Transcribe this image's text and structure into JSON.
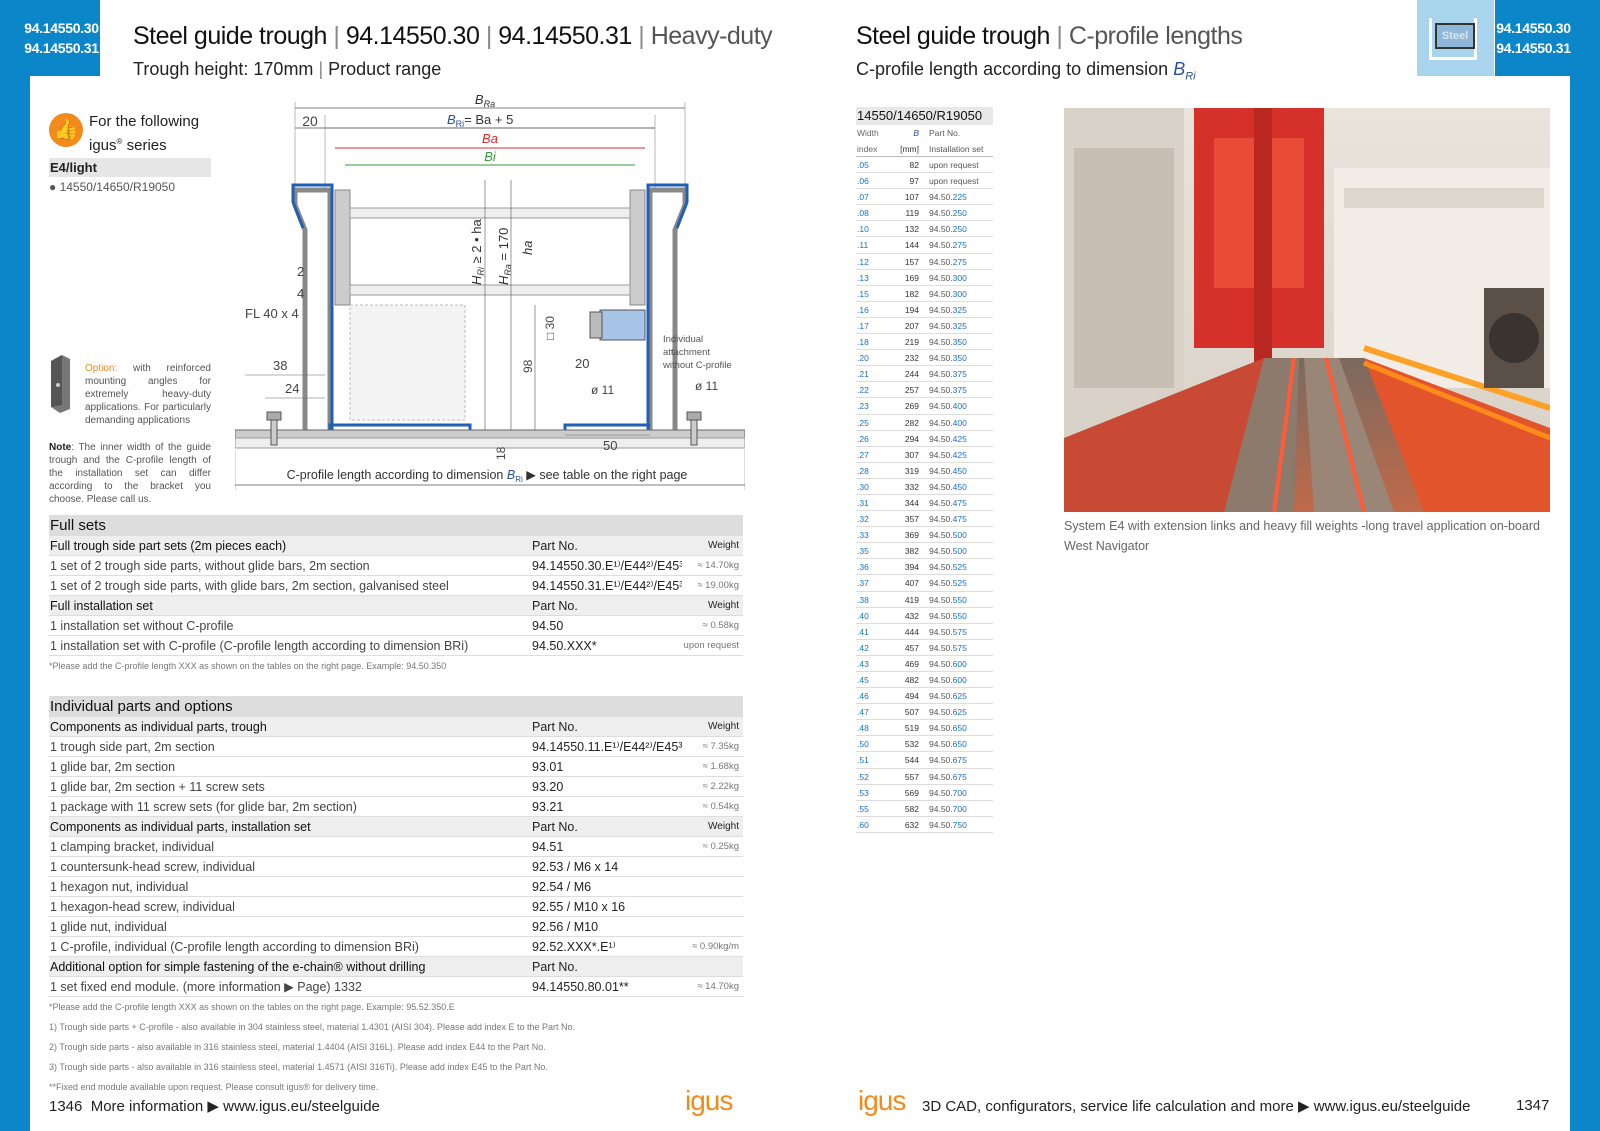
{
  "left_tab": [
    "94.14550.30",
    "94.14550.31"
  ],
  "right_tab": [
    "94.14550.30",
    "94.14550.31"
  ],
  "steel_badge": "Steel",
  "left_title": {
    "a": "Steel guide trough",
    "b": "94.14550.30",
    "c": "94.14550.31",
    "d": "Heavy-duty"
  },
  "left_subtitle": {
    "a": "Trough height: 170mm",
    "b": "Product range"
  },
  "right_title": {
    "a": "Steel guide trough",
    "b": "C-profile lengths"
  },
  "right_subtitle": {
    "a": "C-profile length according to dimension",
    "b": "B",
    "sub": "Ri"
  },
  "series": {
    "line1": "For the following",
    "line2a": "igus",
    "reg": "®",
    "line2b": " series",
    "heading": "E4/light",
    "bullet": "● 14550/14650/R19050"
  },
  "option_text": {
    "label": "Option:",
    "text": " with reinforced mounting angles for extremely heavy-duty applications. For particularly demanding applications"
  },
  "note_text": {
    "label": "Note",
    "text": ": The inner width of the guide trough and the C-profile length of the installation set can differ according to the bracket you choose. Please call us."
  },
  "drawing": {
    "bra": "B",
    "bra_sub": "Ra",
    "bri_eq": "= Ba + 5",
    "bri": "B",
    "bri_sub": "Ri",
    "ba": "Ba",
    "bi": "Bi",
    "d20": "20",
    "d2": "2",
    "d4": "4",
    "fl": "FL 40 x 4",
    "d38": "38",
    "d24": "24",
    "hri": "H",
    "hri_sub": "Ri",
    "hri_rest": " ≥ 2 • ha",
    "hra": "H",
    "hra_sub": "Ra",
    "hra_rest": " = 170",
    "ha": "ha",
    "d30": "□ 30",
    "d98": "98",
    "d20b": "20",
    "d11a": "ø 11",
    "d11b": "ø 11",
    "d18": "18",
    "d50": "50",
    "individual": [
      "Individual",
      "attachment",
      "without C-profile"
    ],
    "cprofile": "C-profile length according to dimension",
    "cprofile_b": "B",
    "cprofile_sub": "Ri",
    "cprofile_rest": "▶ see table on the right page"
  },
  "full_sets": {
    "title": "Full sets",
    "groups": [
      {
        "header": [
          "Full trough side part sets (2m pieces each)",
          "Part No.",
          "Weight"
        ],
        "rows": [
          [
            "1 set of 2 trough side parts, without glide bars, 2m section",
            "94.14550.30.E¹⁾/E44²⁾/E45³⁾",
            "≈ 14.70kg"
          ],
          [
            "1 set of 2 trough side parts, with glide bars, 2m section, galvanised steel",
            "94.14550.31.E¹⁾/E44²⁾/E45³⁾",
            "≈ 19.00kg"
          ]
        ]
      },
      {
        "header": [
          "Full installation set",
          "Part No.",
          "Weight"
        ],
        "rows": [
          [
            "1 installation set without C-profile",
            "94.50",
            "≈ 0.58kg"
          ],
          [
            "1 installation set with C-profile (C-profile length according to dimension BRi)",
            "94.50.XXX*",
            "upon request"
          ]
        ]
      }
    ],
    "note": "*Please add the C-profile length XXX as shown on the tables on the right page. Example: 94.50.350"
  },
  "individual_parts": {
    "title": "Individual parts and options",
    "groups": [
      {
        "header": [
          "Components as individual parts, trough",
          "Part No.",
          "Weight"
        ],
        "rows": [
          [
            "1 trough side part, 2m section",
            "94.14550.11.E¹⁾/E44²⁾/E45³⁾",
            "≈ 7.35kg"
          ],
          [
            "1 glide bar, 2m section",
            "93.01",
            "≈ 1.68kg"
          ],
          [
            "1 glide bar, 2m section + 11 screw sets",
            "93.20",
            "≈ 2.22kg"
          ],
          [
            "1 package with 11 screw sets (for glide bar, 2m section)",
            "93.21",
            "≈ 0.54kg"
          ]
        ]
      },
      {
        "header": [
          "Components as individual parts, installation set",
          "Part No.",
          "Weight"
        ],
        "rows": [
          [
            "1 clamping bracket, individual",
            "94.51",
            "≈ 0.25kg"
          ],
          [
            "1 countersunk-head screw, individual",
            "92.53 / M6 x 14",
            ""
          ],
          [
            "1 hexagon nut, individual",
            "92.54 / M6",
            ""
          ],
          [
            "1 hexagon-head screw, individual",
            "92.55 / M10 x 16",
            ""
          ],
          [
            "1 glide nut, individual",
            "92.56 / M10",
            ""
          ],
          [
            "1 C-profile, individual (C-profile length according to dimension BRi)",
            "92.52.XXX*.E¹⁾",
            "≈ 0.90kg/m"
          ]
        ]
      },
      {
        "header": [
          "Additional option for simple fastening of the e-chain® without drilling",
          "Part No.",
          ""
        ],
        "rows": [
          [
            "1 set fixed end module. (more information ▶ Page) 1332",
            "94.14550.80.01**",
            "≈ 14.70kg"
          ]
        ]
      }
    ],
    "notes": [
      "*Please add the C-profile length XXX as shown on the tables on the right page. Example: 95.52.350.E",
      "1) Trough side parts + C-profile - also available in 304 stainless steel, material 1.4301 (AISI 304). Please add index E to the Part No.",
      "2) Trough side parts - also available in 316 stainless steel, material 1.4404 (AISI 316L). Please add index E44 to the Part No.",
      "3) Trough side parts - also available in 316 stainless steel, material 1.4571 (AISI 316Ti). Please add index E45 to the Part No.",
      "**Fixed end module available upon request. Please consult igus® for delivery time."
    ]
  },
  "length_table": {
    "title": "14550/14650/R19050",
    "sub1": [
      "Width",
      "B",
      "Part No."
    ],
    "sub2": [
      "index",
      "[mm]",
      "Installation set"
    ],
    "rows": [
      [
        ".05",
        "82",
        "upon request"
      ],
      [
        ".06",
        "97",
        "upon request"
      ],
      [
        ".07",
        "107",
        "94.50.225"
      ],
      [
        ".08",
        "119",
        "94.50.250"
      ],
      [
        ".10",
        "132",
        "94.50.250"
      ],
      [
        ".11",
        "144",
        "94.50.275"
      ],
      [
        ".12",
        "157",
        "94.50.275"
      ],
      [
        ".13",
        "169",
        "94.50.300"
      ],
      [
        ".15",
        "182",
        "94.50.300"
      ],
      [
        ".16",
        "194",
        "94.50.325"
      ],
      [
        ".17",
        "207",
        "94.50.325"
      ],
      [
        ".18",
        "219",
        "94.50.350"
      ],
      [
        ".20",
        "232",
        "94.50.350"
      ],
      [
        ".21",
        "244",
        "94.50.375"
      ],
      [
        ".22",
        "257",
        "94.50.375"
      ],
      [
        ".23",
        "269",
        "94.50.400"
      ],
      [
        ".25",
        "282",
        "94.50.400"
      ],
      [
        ".26",
        "294",
        "94.50.425"
      ],
      [
        ".27",
        "307",
        "94.50.425"
      ],
      [
        ".28",
        "319",
        "94.50.450"
      ],
      [
        ".30",
        "332",
        "94.50.450"
      ],
      [
        ".31",
        "344",
        "94.50.475"
      ],
      [
        ".32",
        "357",
        "94.50.475"
      ],
      [
        ".33",
        "369",
        "94.50.500"
      ],
      [
        ".35",
        "382",
        "94.50.500"
      ],
      [
        ".36",
        "394",
        "94.50.525"
      ],
      [
        ".37",
        "407",
        "94.50.525"
      ],
      [
        ".38",
        "419",
        "94.50.550"
      ],
      [
        ".40",
        "432",
        "94.50.550"
      ],
      [
        ".41",
        "444",
        "94.50.575"
      ],
      [
        ".42",
        "457",
        "94.50.575"
      ],
      [
        ".43",
        "469",
        "94.50.600"
      ],
      [
        ".45",
        "482",
        "94.50.600"
      ],
      [
        ".46",
        "494",
        "94.50.625"
      ],
      [
        ".47",
        "507",
        "94.50.625"
      ],
      [
        ".48",
        "519",
        "94.50.650"
      ],
      [
        ".50",
        "532",
        "94.50.650"
      ],
      [
        ".51",
        "544",
        "94.50.675"
      ],
      [
        ".52",
        "557",
        "94.50.675"
      ],
      [
        ".53",
        "569",
        "94.50.700"
      ],
      [
        ".55",
        "582",
        "94.50.700"
      ],
      [
        ".60",
        "632",
        "94.50.750"
      ]
    ]
  },
  "photo_caption": "System E4 with extension links and heavy fill weights -long travel application on-board West Navigator",
  "footer_left": {
    "page": "1346",
    "text": "More information ▶ www.igus.eu/steelguide"
  },
  "footer_right": {
    "text": "3D CAD, configurators, service life calculation and more ▶ www.igus.eu/steelguide",
    "page": "1347"
  },
  "logo": "igus",
  "colors": {
    "accent": "#0b86c8",
    "red": "#e3262d",
    "green": "#3a9a3a",
    "blue_text": "#1a6fc4",
    "orange": "#f28a1c"
  }
}
